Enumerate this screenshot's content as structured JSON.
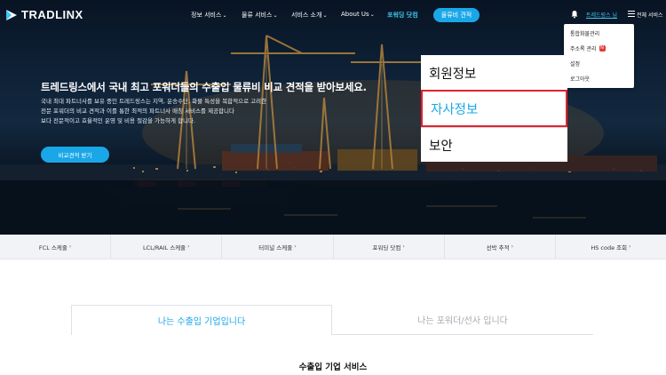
{
  "brand": {
    "logo_text": "TRADLINX"
  },
  "nav": {
    "menu": [
      {
        "label": "정보 서비스",
        "caret": "⌄"
      },
      {
        "label": "물류 서비스",
        "caret": "⌄"
      },
      {
        "label": "서비스 소개",
        "caret": "⌄"
      },
      {
        "label": "About Us",
        "caret": "⌄"
      }
    ],
    "forwarding_label": "포워딩 닷컴",
    "quote_button": "물류비 견적",
    "user_name": "트레드링스 님",
    "all_services": "전체 서비스",
    "bell_icon": "bell-icon",
    "menu_icon": "hamburger-icon"
  },
  "hero": {
    "title": "트레드링스에서 국내 최고 포워더들의 수출입 물류비 비교 견적을 받아보세요.",
    "description": [
      "국내 최대 파트너사를 보유 중인 트레드링스는 지역, 운송수단, 화물 특성을 복합적으로 고려한",
      "전문 포워더의 비교 견적과 이를 통한 최적의 파트너사 매칭 서비스를 제공합니다",
      "보다 전문적이고 효율적인 운영 및 비용 절감을 가능하게 합니다."
    ],
    "cta": "비교견적 받기"
  },
  "user_dropdown": {
    "items": [
      {
        "label": "통합화물관리"
      },
      {
        "label": "주소록 관리",
        "badge": "N"
      },
      {
        "label": "설정"
      },
      {
        "label": "로그아웃"
      }
    ]
  },
  "settings_dropdown": {
    "items": [
      {
        "label": "회원정보"
      },
      {
        "label": "자사정보",
        "active": true
      },
      {
        "label": "보안"
      }
    ],
    "highlight_color": "#e0232e"
  },
  "quick_links": [
    {
      "label": "FCL 스케줄"
    },
    {
      "label": "LCL/RAIL 스케줄"
    },
    {
      "label": "터미널 스케줄"
    },
    {
      "label": "포워딩 닷컴"
    },
    {
      "label": "선박 추적"
    },
    {
      "label": "HS code 조회"
    }
  ],
  "tabs": [
    {
      "label": "나는 수출입 기업입니다",
      "active": true
    },
    {
      "label": "나는 포워더/선사 입니다",
      "active": false
    }
  ],
  "section": {
    "title": "수출입 기업 서비스"
  },
  "colors": {
    "accent": "#1aa7e8",
    "accent_text": "#3ec7f0",
    "danger": "#e53935"
  }
}
